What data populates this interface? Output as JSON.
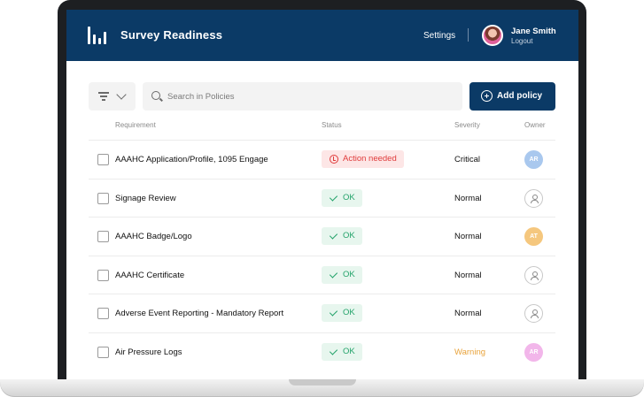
{
  "app": {
    "title": "Survey Readiness"
  },
  "header": {
    "settings_label": "Settings",
    "user_name": "Jane Smith",
    "logout_label": "Logout"
  },
  "toolbar": {
    "search_placeholder": "Search in Policies",
    "add_label": "Add policy"
  },
  "table": {
    "columns": [
      "Requirement",
      "Status",
      "Severity",
      "Owner"
    ],
    "rows": [
      {
        "requirement": "AAAHC Application/Profile, 1095 Engage",
        "status": "Action needed",
        "severity": "Critical",
        "owner": "AR"
      },
      {
        "requirement": "Signage Review",
        "status": "OK",
        "severity": "Normal",
        "owner": ""
      },
      {
        "requirement": "AAAHC Badge/Logo",
        "status": "OK",
        "severity": "Normal",
        "owner": "AT"
      },
      {
        "requirement": "AAAHC Certificate",
        "status": "OK",
        "severity": "Normal",
        "owner": ""
      },
      {
        "requirement": "Adverse Event Reporting - Mandatory Report",
        "status": "OK",
        "severity": "Normal",
        "owner": ""
      },
      {
        "requirement": "Air Pressure Logs",
        "status": "OK",
        "severity": "Warning",
        "owner": "AR"
      }
    ]
  },
  "colors": {
    "brand": "#0b3a66",
    "ok": "#23a36a",
    "alert": "#e03b3b",
    "warning": "#e8a33b",
    "owner_blue": "#a9c8ee",
    "owner_orange": "#f5c77e",
    "owner_pink": "#f2b6ea"
  }
}
